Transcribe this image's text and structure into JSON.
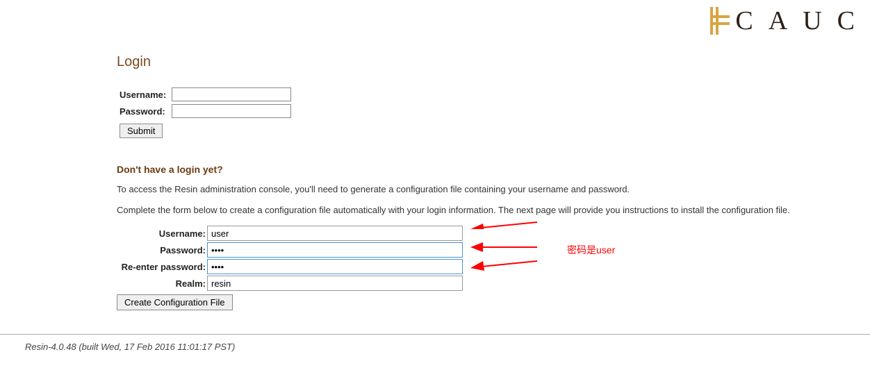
{
  "logo_text": "CAUC",
  "login": {
    "title": "Login",
    "username_label": "Username:",
    "password_label": "Password:",
    "username_value": "",
    "password_value": "",
    "submit_label": "Submit"
  },
  "signup": {
    "heading": "Don't have a login yet?",
    "desc1": "To access the Resin administration console, you'll need to generate a configuration file containing your username and password.",
    "desc2": "Complete the form below to create a configuration file automatically with your login information. The next page will provide you instructions to install the configuration file.",
    "username_label": "Username:",
    "password_label": "Password:",
    "repassword_label": "Re-enter password:",
    "realm_label": "Realm:",
    "username_value": "user",
    "password_value": "user",
    "repassword_value": "user",
    "realm_value": "resin",
    "create_label": "Create Configuration File"
  },
  "footer": "Resin-4.0.48 (built Wed, 17 Feb 2016 11:01:17 PST)",
  "annotation": "密码是user"
}
